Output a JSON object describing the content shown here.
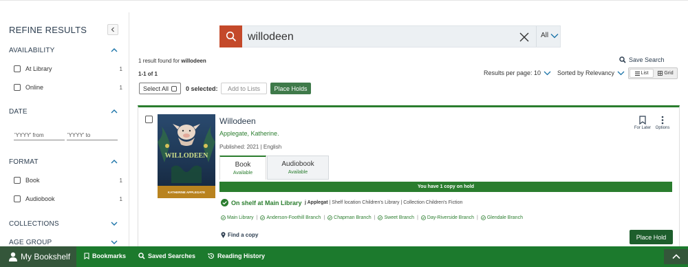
{
  "sidebar": {
    "title": "REFINE RESULTS",
    "sections": [
      {
        "title": "AVAILABILITY",
        "expanded": true,
        "options": [
          {
            "label": "At Library",
            "count": "1"
          },
          {
            "label": "Online",
            "count": "1"
          }
        ]
      },
      {
        "title": "DATE",
        "expanded": true,
        "from_placeholder": "'YYYY' from",
        "to_placeholder": "'YYYY' to"
      },
      {
        "title": "FORMAT",
        "expanded": true,
        "options": [
          {
            "label": "Book",
            "count": "1"
          },
          {
            "label": "Audiobook",
            "count": "1"
          }
        ]
      },
      {
        "title": "COLLECTIONS",
        "expanded": false
      },
      {
        "title": "AGE GROUP",
        "expanded": false
      }
    ]
  },
  "search": {
    "query": "willodeen",
    "scope": "All"
  },
  "results": {
    "found_prefix": "1 result found for",
    "found_term": "willodeen",
    "range": "1-1 of 1",
    "save_search": "Save Search",
    "per_page_label": "Results per page: 10",
    "sort_label": "Sorted by Relevancy",
    "view_list": "List",
    "view_grid": "Grid"
  },
  "actions": {
    "select_all": "Select All",
    "selected": "0 selected:",
    "add_to_lists": "Add to Lists",
    "place_holds": "Place Holds"
  },
  "item": {
    "title": "Willodeen",
    "author": "Applegate, Katherine.",
    "published": "Published: 2021 | English",
    "cover_title": "WILLODEEN",
    "cover_author": "KATHERINE APPLEGATE",
    "formats": [
      {
        "name": "Book",
        "status": "Available"
      },
      {
        "name": "Audiobook",
        "status": "Available"
      }
    ],
    "hold_notice": "You have 1 copy on hold",
    "shelf_status": "On shelf at Main Library",
    "call_number": "j Applegat",
    "shelf_detail": "| Shelf location Children's Library | Collection Children's Fiction",
    "branches": [
      "Main Library",
      "Anderson-Foothill Branch",
      "Chapman Branch",
      "Sweet Branch",
      "Day-Riverside Branch",
      "Glendale Branch"
    ],
    "find_copy": "Find a copy",
    "place_hold": "Place Hold",
    "for_later": "For Later",
    "options": "Options"
  },
  "bottom_bar": {
    "bookshelf": "My Bookshelf",
    "bookmarks": "Bookmarks",
    "saved_searches": "Saved Searches",
    "reading_history": "Reading History"
  },
  "colors": {
    "accent_green": "#2a7d2e",
    "search_button": "#c4492a",
    "bottom_bar": "#1c7a2d",
    "navy_text": "#2d3e50"
  }
}
